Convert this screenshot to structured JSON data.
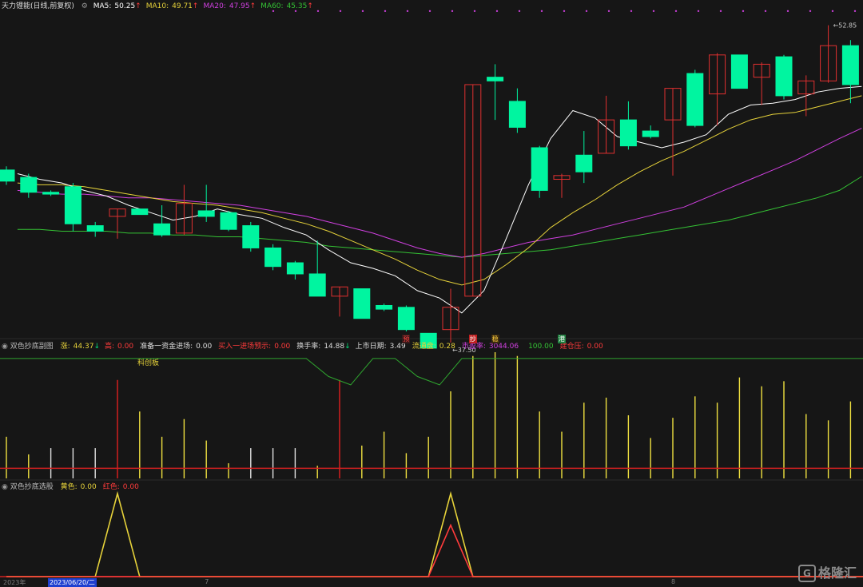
{
  "main_title": {
    "name": "天力锂能(日线,前复权)",
    "ma": [
      {
        "label": "MA5:",
        "value": "50.25",
        "color": "#ffffff"
      },
      {
        "label": "MA10:",
        "value": "49.71",
        "color": "#e6d23a"
      },
      {
        "label": "MA20:",
        "value": "47.95",
        "color": "#d040e0"
      },
      {
        "label": "MA60:",
        "value": "45.35",
        "color": "#34c234"
      }
    ]
  },
  "sub1_title": {
    "name": "双色抄底副图",
    "items": [
      {
        "label": "涨:",
        "value": "44.37",
        "color": "#e6d23a",
        "arrow": "↓"
      },
      {
        "label": "高:",
        "value": "0.00",
        "color": "#ff3b3b",
        "arrow": ""
      },
      {
        "label": "准备一资金进场:",
        "value": "0.00",
        "color": "#dddddd",
        "arrow": ""
      },
      {
        "label": "买入一进场预示:",
        "value": "0.00",
        "color": "#ff3b3b",
        "arrow": ""
      },
      {
        "label": "换手率:",
        "value": "14.88",
        "color": "#dddddd",
        "arrow": "↓"
      },
      {
        "label": "上市日期:",
        "value": "3.49",
        "color": "#dddddd",
        "arrow": ""
      },
      {
        "label": "流通盘:",
        "value": "0.28",
        "color": "#e6d23a",
        "arrow": ""
      },
      {
        "label": "市盈率:",
        "value": "3044.06",
        "color": "#d040e0",
        "arrow": ""
      },
      {
        "label": "",
        "value": "100.00",
        "color": "#34c234",
        "arrow": ""
      },
      {
        "label": "建仓压:",
        "value": "0.00",
        "color": "#ff3b3b",
        "arrow": ""
      }
    ],
    "board_label": "科创板"
  },
  "sub2_title": {
    "name": "双色抄底选股",
    "items": [
      {
        "label": "黄色:",
        "value": "0.00",
        "color": "#e6d23a"
      },
      {
        "label": "红色:",
        "value": "0.00",
        "color": "#ff3b3b"
      }
    ]
  },
  "x_axis": {
    "year_label": "2023年",
    "cursor_date": "2023/06/20/二",
    "month_ticks": [
      {
        "text": "7",
        "index": 9
      },
      {
        "text": "8",
        "index": 30
      }
    ]
  },
  "signals": [
    {
      "text": "预",
      "index": 18,
      "color": "#ff4040",
      "bg": "#3a1a1a"
    },
    {
      "text": "抄",
      "index": 21,
      "color": "#ffffff",
      "bg": "#c02020"
    },
    {
      "text": "稳",
      "index": 22,
      "color": "#ffd040",
      "bg": "#3a2a10"
    },
    {
      "text": "港",
      "index": 25,
      "color": "#ffffff",
      "bg": "#208040"
    }
  ],
  "watermark": "格隆汇",
  "colors": {
    "background": "#161616",
    "up": "#e03030",
    "down": "#00f5a0",
    "ma5": "#ffffff",
    "ma10": "#e6d23a",
    "ma20": "#d040e0",
    "ma60": "#34c234",
    "bar_yellow": "#f0e040",
    "bar_red": "#e02020",
    "bar_white": "#e0e0e0"
  },
  "chart_data": [
    {
      "type": "candlestick",
      "title": "天力锂能(日线,前复权)",
      "max_label": "52.85",
      "min_label": "37.50",
      "price_range": [
        37.0,
        54.0
      ],
      "candles": [
        {
          "o": 45.7,
          "h": 45.9,
          "l": 44.9,
          "c": 45.1
        },
        {
          "o": 45.3,
          "h": 45.5,
          "l": 44.2,
          "c": 44.5
        },
        {
          "o": 44.5,
          "h": 44.6,
          "l": 44.3,
          "c": 44.4
        },
        {
          "o": 44.8,
          "h": 45.0,
          "l": 42.4,
          "c": 42.8
        },
        {
          "o": 42.7,
          "h": 42.9,
          "l": 42.1,
          "c": 42.4
        },
        {
          "o": 43.2,
          "h": 43.6,
          "l": 42.0,
          "c": 43.6
        },
        {
          "o": 43.6,
          "h": 43.6,
          "l": 43.3,
          "c": 43.3
        },
        {
          "o": 42.8,
          "h": 43.8,
          "l": 42.1,
          "c": 42.2
        },
        {
          "o": 42.3,
          "h": 44.9,
          "l": 42.2,
          "c": 43.9
        },
        {
          "o": 43.5,
          "h": 44.9,
          "l": 42.9,
          "c": 43.2
        },
        {
          "o": 43.4,
          "h": 43.5,
          "l": 42.4,
          "c": 42.5
        },
        {
          "o": 42.7,
          "h": 42.9,
          "l": 41.3,
          "c": 41.5
        },
        {
          "o": 41.5,
          "h": 41.7,
          "l": 40.3,
          "c": 40.5
        },
        {
          "o": 40.7,
          "h": 40.8,
          "l": 39.8,
          "c": 40.1
        },
        {
          "o": 40.1,
          "h": 41.9,
          "l": 38.9,
          "c": 38.9
        },
        {
          "o": 38.9,
          "h": 39.4,
          "l": 37.8,
          "c": 39.4
        },
        {
          "o": 39.3,
          "h": 39.3,
          "l": 37.7,
          "c": 37.7
        },
        {
          "o": 38.4,
          "h": 38.5,
          "l": 38.1,
          "c": 38.2
        },
        {
          "o": 38.3,
          "h": 38.4,
          "l": 37.0,
          "c": 37.1
        },
        {
          "o": 36.9,
          "h": 36.9,
          "l": 37.5,
          "c": 36.1
        },
        {
          "o": 37.1,
          "h": 39.3,
          "l": 36.4,
          "c": 38.3
        },
        {
          "o": 38.9,
          "h": 50.3,
          "l": 38.9,
          "c": 50.3
        },
        {
          "o": 50.7,
          "h": 51.4,
          "l": 48.4,
          "c": 50.5
        },
        {
          "o": 49.4,
          "h": 50.1,
          "l": 47.7,
          "c": 48.0
        },
        {
          "o": 46.9,
          "h": 47.0,
          "l": 44.2,
          "c": 44.6
        },
        {
          "o": 45.2,
          "h": 45.5,
          "l": 44.2,
          "c": 45.4
        },
        {
          "o": 46.5,
          "h": 47.8,
          "l": 45.0,
          "c": 45.6
        },
        {
          "o": 46.6,
          "h": 49.7,
          "l": 46.6,
          "c": 48.4
        },
        {
          "o": 48.4,
          "h": 49.4,
          "l": 46.8,
          "c": 47.0
        },
        {
          "o": 47.8,
          "h": 48.1,
          "l": 47.4,
          "c": 47.5
        },
        {
          "o": 48.4,
          "h": 50.1,
          "l": 45.4,
          "c": 50.1
        },
        {
          "o": 50.9,
          "h": 51.1,
          "l": 48.0,
          "c": 48.1
        },
        {
          "o": 49.8,
          "h": 52.0,
          "l": 48.1,
          "c": 51.9
        },
        {
          "o": 51.9,
          "h": 51.9,
          "l": 50.1,
          "c": 50.1
        },
        {
          "o": 50.7,
          "h": 51.5,
          "l": 49.2,
          "c": 51.4
        },
        {
          "o": 51.8,
          "h": 51.9,
          "l": 49.5,
          "c": 49.7
        },
        {
          "o": 49.8,
          "h": 50.8,
          "l": 48.6,
          "c": 50.5
        },
        {
          "o": 50.5,
          "h": 53.5,
          "l": 50.4,
          "c": 52.4
        },
        {
          "o": 52.4,
          "h": 52.7,
          "l": 49.3,
          "c": 50.3
        }
      ],
      "ma5": [
        45.5,
        45.2,
        45.0,
        44.6,
        44.3,
        43.8,
        43.4,
        43.0,
        43.2,
        43.6,
        43.3,
        43.1,
        42.6,
        42.2,
        41.4,
        40.7,
        40.4,
        40.0,
        39.2,
        38.8,
        38.0,
        39.2,
        42.0,
        44.9,
        47.4,
        48.9,
        48.5,
        47.5,
        47.2,
        46.9,
        47.2,
        47.6,
        48.7,
        49.2,
        49.3,
        49.5,
        49.9,
        50.1,
        50.2
      ],
      "ma10": [
        45.0,
        44.9,
        44.9,
        44.8,
        44.6,
        44.4,
        44.2,
        44.0,
        43.9,
        43.8,
        43.6,
        43.4,
        43.1,
        42.8,
        42.4,
        41.9,
        41.4,
        40.9,
        40.3,
        39.8,
        39.5,
        39.8,
        40.6,
        41.5,
        42.6,
        43.4,
        44.1,
        44.9,
        45.6,
        46.2,
        46.7,
        47.3,
        47.9,
        48.4,
        48.7,
        48.8,
        49.1,
        49.4,
        49.7
      ],
      "ma20": [
        44.6,
        44.5,
        44.4,
        44.4,
        44.3,
        44.2,
        44.2,
        44.1,
        44.0,
        43.9,
        43.8,
        43.6,
        43.4,
        43.2,
        42.9,
        42.6,
        42.3,
        41.9,
        41.5,
        41.2,
        41.0,
        41.2,
        41.5,
        41.8,
        42.0,
        42.2,
        42.5,
        42.8,
        43.1,
        43.4,
        43.7,
        44.2,
        44.7,
        45.2,
        45.7,
        46.2,
        46.8,
        47.4,
        47.95
      ],
      "ma60": [
        42.5,
        42.5,
        42.4,
        42.4,
        42.4,
        42.3,
        42.3,
        42.2,
        42.2,
        42.1,
        42.1,
        42.0,
        41.9,
        41.8,
        41.6,
        41.5,
        41.4,
        41.3,
        41.2,
        41.1,
        41.0,
        41.1,
        41.2,
        41.3,
        41.4,
        41.6,
        41.8,
        42.0,
        42.2,
        42.4,
        42.6,
        42.8,
        43.0,
        43.3,
        43.6,
        43.9,
        44.2,
        44.6,
        45.35
      ]
    },
    {
      "type": "bar",
      "title": "双色抄底副图",
      "range": [
        0,
        100
      ],
      "red_line_level": 8,
      "step_line": [
        100,
        100,
        100,
        100,
        100,
        100,
        100,
        100,
        100,
        100,
        100,
        100,
        100,
        100,
        85,
        78,
        100,
        100,
        85,
        78,
        100,
        100,
        100,
        100,
        100,
        100,
        100,
        100,
        100,
        100,
        100,
        100,
        100,
        100,
        100,
        100,
        100,
        100,
        100
      ],
      "bars": [
        {
          "v": 33,
          "c": "yellow"
        },
        {
          "v": 19,
          "c": "yellow"
        },
        {
          "v": 24,
          "c": "white"
        },
        {
          "v": 24,
          "c": "white"
        },
        {
          "v": 24,
          "c": "white"
        },
        {
          "v": 78,
          "c": "red"
        },
        {
          "v": 53,
          "c": "yellow"
        },
        {
          "v": 33,
          "c": "yellow"
        },
        {
          "v": 47,
          "c": "yellow"
        },
        {
          "v": 30,
          "c": "yellow"
        },
        {
          "v": 12,
          "c": "yellow"
        },
        {
          "v": 24,
          "c": "white"
        },
        {
          "v": 24,
          "c": "white"
        },
        {
          "v": 24,
          "c": "white"
        },
        {
          "v": 10,
          "c": "yellow"
        },
        {
          "v": 78,
          "c": "red"
        },
        {
          "v": 26,
          "c": "yellow"
        },
        {
          "v": 37,
          "c": "yellow"
        },
        {
          "v": 20,
          "c": "yellow"
        },
        {
          "v": 33,
          "c": "yellow"
        },
        {
          "v": 69,
          "c": "yellow"
        },
        {
          "v": 97,
          "c": "yellow"
        },
        {
          "v": 100,
          "c": "yellow"
        },
        {
          "v": 97,
          "c": "yellow"
        },
        {
          "v": 53,
          "c": "yellow"
        },
        {
          "v": 37,
          "c": "yellow"
        },
        {
          "v": 60,
          "c": "yellow"
        },
        {
          "v": 64,
          "c": "yellow"
        },
        {
          "v": 50,
          "c": "yellow"
        },
        {
          "v": 32,
          "c": "yellow"
        },
        {
          "v": 48,
          "c": "yellow"
        },
        {
          "v": 65,
          "c": "yellow"
        },
        {
          "v": 60,
          "c": "yellow"
        },
        {
          "v": 80,
          "c": "yellow"
        },
        {
          "v": 73,
          "c": "yellow"
        },
        {
          "v": 77,
          "c": "yellow"
        },
        {
          "v": 51,
          "c": "yellow"
        },
        {
          "v": 46,
          "c": "yellow"
        },
        {
          "v": 61,
          "c": "yellow"
        },
        {
          "v": 45,
          "c": "yellow"
        }
      ]
    },
    {
      "type": "line",
      "title": "双色抄底选股",
      "range": [
        0,
        1
      ],
      "series": [
        {
          "name": "黄色",
          "color": "#e6d23a",
          "values": [
            0,
            0,
            0,
            0,
            0,
            1,
            0,
            0,
            0,
            0,
            0,
            0,
            0,
            0,
            0,
            0,
            0,
            0,
            0,
            0,
            1,
            0,
            0,
            0,
            0,
            0,
            0,
            0,
            0,
            0,
            0,
            0,
            0,
            0,
            0,
            0,
            0,
            0,
            0,
            0
          ]
        },
        {
          "name": "红色",
          "color": "#ff3b3b",
          "values": [
            0,
            0,
            0,
            0,
            0,
            0,
            0,
            0,
            0,
            0,
            0,
            0,
            0,
            0,
            0,
            0,
            0,
            0,
            0,
            0,
            0.62,
            0,
            0,
            0,
            0,
            0,
            0,
            0,
            0,
            0,
            0,
            0,
            0,
            0,
            0,
            0,
            0,
            0,
            0,
            0
          ]
        }
      ]
    }
  ]
}
